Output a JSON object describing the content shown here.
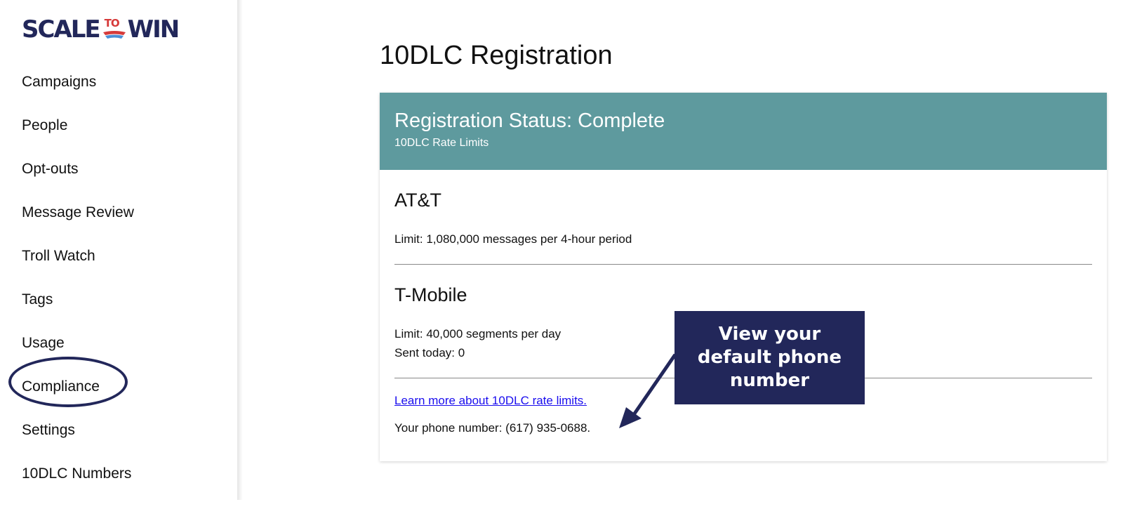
{
  "brand": {
    "logo_left": "SCALE",
    "logo_mid": "TO",
    "logo_right": "WIN",
    "primary_color": "#22275a",
    "accent_red": "#d63a3a",
    "accent_blue": "#4a8fd6"
  },
  "sidebar": {
    "items": [
      {
        "label": "Campaigns"
      },
      {
        "label": "People"
      },
      {
        "label": "Opt-outs"
      },
      {
        "label": "Message Review"
      },
      {
        "label": "Troll Watch"
      },
      {
        "label": "Tags"
      },
      {
        "label": "Usage"
      },
      {
        "label": "Compliance",
        "highlighted": true
      },
      {
        "label": "Settings"
      },
      {
        "label": "10DLC Numbers"
      }
    ]
  },
  "main": {
    "title": "10DLC Registration",
    "card": {
      "header_title": "Registration Status: Complete",
      "header_subtitle": "10DLC Rate Limits",
      "header_color": "#5e9a9e",
      "carriers": [
        {
          "name": "AT&T",
          "lines": [
            "Limit: 1,080,000 messages per 4-hour period"
          ]
        },
        {
          "name": "T-Mobile",
          "lines": [
            "Limit: 40,000 segments per day",
            "Sent today: 0"
          ]
        }
      ],
      "learn_link": "Learn more about 10DLC rate limits.",
      "phone_line": "Your phone number: (617) 935-0688."
    }
  },
  "callout": {
    "text": "View your default phone number"
  }
}
